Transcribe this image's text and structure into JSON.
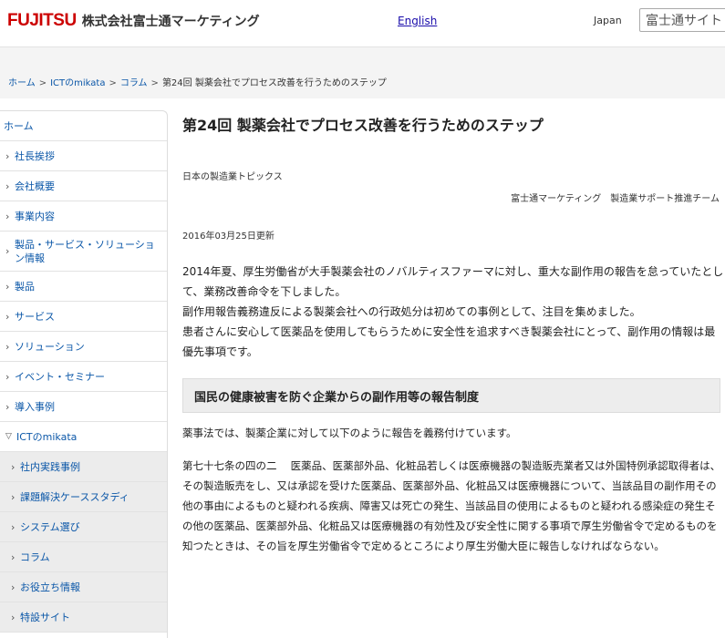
{
  "header": {
    "brand": "FUJITSU",
    "company": "株式会社富士通マーケティング",
    "lang_link": "English",
    "region": "Japan",
    "search_value": "富士通サイト"
  },
  "breadcrumb": {
    "items": [
      "ホーム",
      "ICTのmikata",
      "コラム"
    ],
    "current": "第24回 製薬会社でプロセス改善を行うためのステップ",
    "separator": ">"
  },
  "sidebar": {
    "home": "ホーム",
    "items": [
      "社長挨拶",
      "会社概要",
      "事業内容",
      "製品・サービス・ソリューション情報",
      "製品",
      "サービス",
      "ソリューション",
      "イベント・セミナー",
      "導入事例"
    ],
    "open_section": "ICTのmikata",
    "sub_items": [
      "社内実践事例",
      "課題解決ケーススタディ",
      "システム選び",
      "コラム",
      "お役立ち情報",
      "特設サイト"
    ]
  },
  "article": {
    "title": "第24回 製薬会社でプロセス改善を行うためのステップ",
    "category": "日本の製造業トピックス",
    "author": "富士通マーケティング　製造業サポート推進チーム",
    "updated": "2016年03月25日更新",
    "intro": [
      "2014年夏、厚生労働省が大手製薬会社のノバルティスファーマに対し、重大な副作用の報告を怠っていたとして、業務改善命令を下しました。",
      "副作用報告義務違反による製薬会社への行政処分は初めての事例として、注目を集めました。",
      "患者さんに安心して医薬品を使用してもらうために安全性を追求すべき製薬会社にとって、副作用の情報は最優先事項です。"
    ],
    "section_heading": "国民の健康被害を防ぐ企業からの副作用等の報告制度",
    "lead": "薬事法では、製薬企業に対して以下のように報告を義務付けています。",
    "law_text": "第七十七条の四の二　 医薬品、医薬部外品、化粧品若しくは医療機器の製造販売業者又は外国特例承認取得者は、その製造販売をし、又は承認を受けた医薬品、医薬部外品、化粧品又は医療機器について、当該品目の副作用その他の事由によるものと疑われる疾病、障害又は死亡の発生、当該品目の使用によるものと疑われる感染症の発生その他の医薬品、医薬部外品、化粧品又は医療機器の有効性及び安全性に関する事項で厚生労働省令で定めるものを知つたときは、その旨を厚生労働省令で定めるところにより厚生労働大臣に報告しなければならない。"
  },
  "colors": {
    "brand_red": "#cc0000",
    "link_blue": "#0b57a8"
  }
}
